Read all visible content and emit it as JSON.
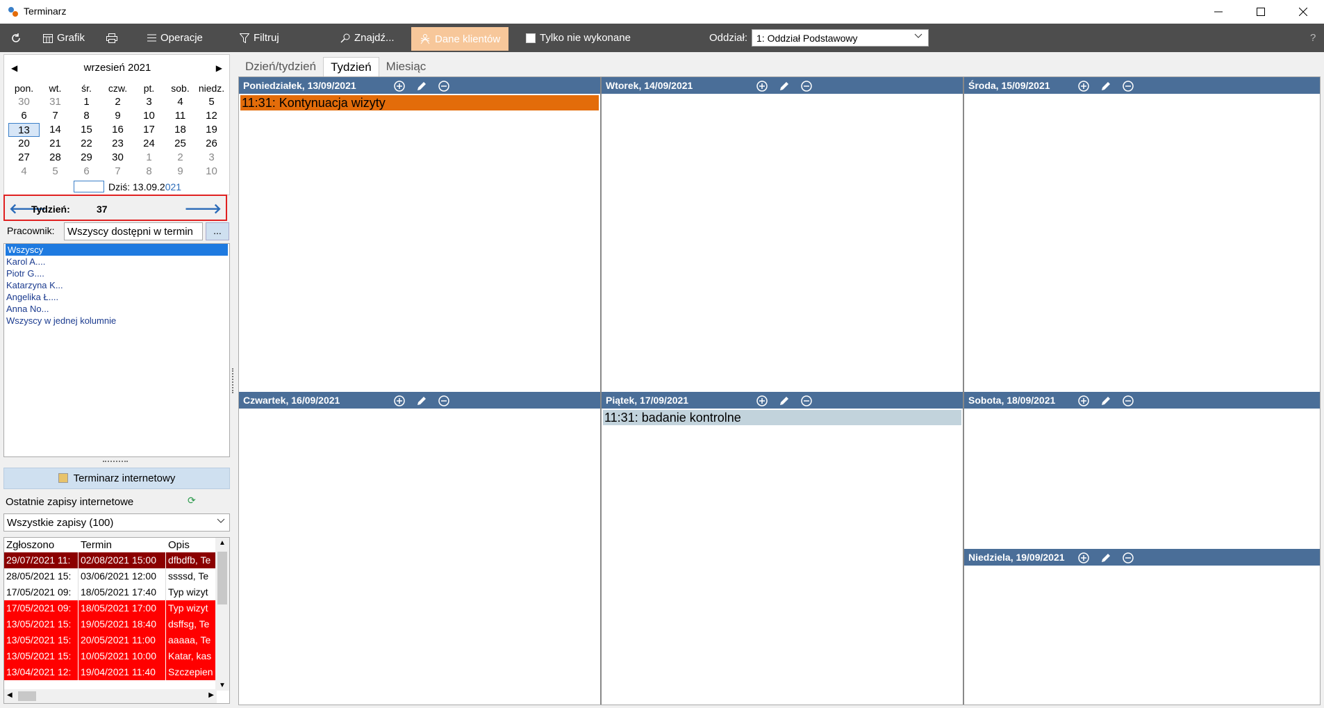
{
  "window": {
    "title": "Terminarz"
  },
  "toolbar": {
    "grafik": "Grafik",
    "operacje": "Operacje",
    "filtruj": "Filtruj",
    "znajdz": "Znajdź...",
    "dane_klientow": "Dane klientów",
    "tylko_nie_wykonane": "Tylko nie wykonane",
    "oddzial_label": "Oddział:",
    "oddzial_value": "1: Oddział Podstawowy",
    "help": "?"
  },
  "calendar": {
    "month_title": "wrzesień 2021",
    "weekdays": [
      "pon.",
      "wt.",
      "śr.",
      "czw.",
      "pt.",
      "sob.",
      "niedz."
    ],
    "weeks": [
      [
        "30",
        "31",
        "1",
        "2",
        "3",
        "4",
        "5"
      ],
      [
        "6",
        "7",
        "8",
        "9",
        "10",
        "11",
        "12"
      ],
      [
        "13",
        "14",
        "15",
        "16",
        "17",
        "18",
        "19"
      ],
      [
        "20",
        "21",
        "22",
        "23",
        "24",
        "25",
        "26"
      ],
      [
        "27",
        "28",
        "29",
        "30",
        "1",
        "2",
        "3"
      ],
      [
        "4",
        "5",
        "6",
        "7",
        "8",
        "9",
        "10"
      ]
    ],
    "today_label": "Dziś: 13.09.2",
    "today_label_suffix": "021"
  },
  "week": {
    "label": "Tydzień:",
    "number": "37"
  },
  "employee": {
    "label": "Pracownik:",
    "select_value": "Wszyscy dostępni w termin",
    "more_button": "...",
    "items": [
      "Wszyscy",
      "Karol A....",
      "Piotr G....",
      "Katarzyna K...",
      "Angelika Ł....",
      "Anna No...",
      "Wszyscy w jednej kolumnie"
    ]
  },
  "web": {
    "button": "Terminarz internetowy",
    "recent_label": "Ostatnie zapisy internetowe",
    "filter_value": "Wszystkie zapisy (100)",
    "headers": [
      "Zgłoszono",
      "Termin",
      "Opis"
    ],
    "rows": [
      {
        "style": "dark",
        "zgloszono": "29/07/2021 11:",
        "termin": "02/08/2021 15:00",
        "opis": "dfbdfb, Te"
      },
      {
        "style": "white",
        "zgloszono": "28/05/2021 15:",
        "termin": "03/06/2021 12:00",
        "opis": "ssssd, Te"
      },
      {
        "style": "white",
        "zgloszono": "17/05/2021 09:",
        "termin": "18/05/2021 17:40",
        "opis": "Typ wizyt"
      },
      {
        "style": "red",
        "zgloszono": "17/05/2021 09:",
        "termin": "18/05/2021 17:00",
        "opis": "Typ wizyt"
      },
      {
        "style": "red",
        "zgloszono": "13/05/2021 15:",
        "termin": "19/05/2021 18:40",
        "opis": "dsffsg, Te"
      },
      {
        "style": "red",
        "zgloszono": "13/05/2021 15:",
        "termin": "20/05/2021 11:00",
        "opis": "aaaaa, Te"
      },
      {
        "style": "red",
        "zgloszono": "13/05/2021 15:",
        "termin": "10/05/2021 10:00",
        "opis": "Katar, kas"
      },
      {
        "style": "red",
        "zgloszono": "13/04/2021 12:",
        "termin": "19/04/2021 11:40",
        "opis": "Szczepien"
      }
    ]
  },
  "tabs": [
    "Dzień/tydzień",
    "Tydzień",
    "Miesiąc"
  ],
  "days": {
    "mon": {
      "title": "Poniedziałek, 13/09/2021",
      "event": "11:31: Kontynuacja wizyty",
      "event_color": "#e36c0a"
    },
    "tue": {
      "title": "Wtorek, 14/09/2021"
    },
    "wed": {
      "title": "Środa, 15/09/2021"
    },
    "thu": {
      "title": "Czwartek, 16/09/2021"
    },
    "fri": {
      "title": "Piątek, 17/09/2021",
      "event": "11:31: badanie kontrolne",
      "event_color": "#c2d3dc"
    },
    "sat": {
      "title": "Sobota, 18/09/2021"
    },
    "sun": {
      "title": "Niedziela, 19/09/2021"
    }
  },
  "colors": {
    "header_blue": "#4a6e98",
    "toolbar_dark": "#4d4d4d",
    "active_orange": "#f7c79a",
    "selection_blue": "#1e7ae0"
  }
}
